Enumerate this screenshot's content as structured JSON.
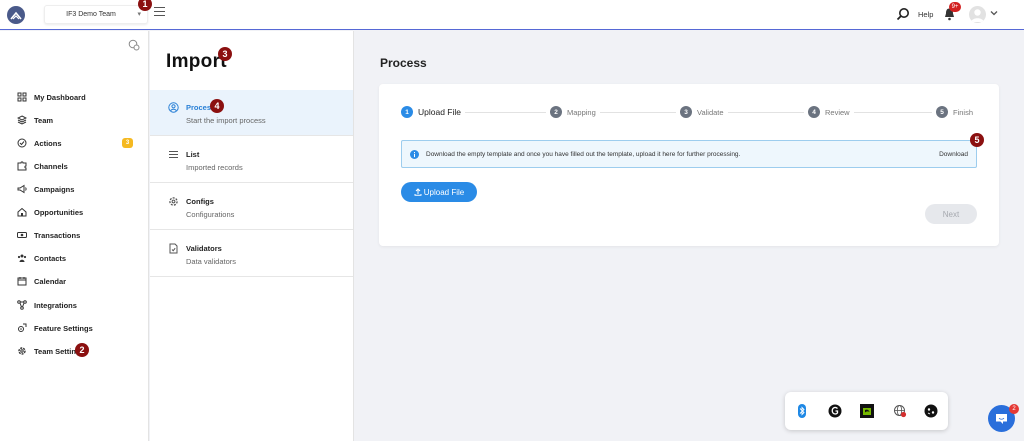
{
  "topbar": {
    "team_name": "IF3 Demo Team",
    "help_label": "Help",
    "notification_count": "9+",
    "accent_color": "#5668d6"
  },
  "callouts": [
    "1",
    "2",
    "3",
    "4",
    "5"
  ],
  "sidebar": {
    "items": [
      {
        "label": "My Dashboard",
        "icon": "grid-icon"
      },
      {
        "label": "Team",
        "icon": "layers-icon"
      },
      {
        "label": "Actions",
        "icon": "check-circle-icon",
        "count": "3"
      },
      {
        "label": "Channels",
        "icon": "puzzle-icon"
      },
      {
        "label": "Campaigns",
        "icon": "megaphone-icon"
      },
      {
        "label": "Opportunities",
        "icon": "home-icon"
      },
      {
        "label": "Transactions",
        "icon": "money-icon"
      },
      {
        "label": "Contacts",
        "icon": "people-icon"
      },
      {
        "label": "Calendar",
        "icon": "calendar-icon"
      },
      {
        "label": "Integrations",
        "icon": "network-icon"
      },
      {
        "label": "Feature Settings",
        "icon": "feature-gear-icon"
      },
      {
        "label": "Team Settings",
        "icon": "gear-icon"
      }
    ]
  },
  "import_panel": {
    "title": "Import",
    "items": [
      {
        "title": "Process",
        "subtitle": "Start the import process",
        "icon": "user-circle-icon",
        "active": true
      },
      {
        "title": "List",
        "subtitle": "Imported records",
        "icon": "list-icon"
      },
      {
        "title": "Configs",
        "subtitle": "Configurations",
        "icon": "cog-icon"
      },
      {
        "title": "Validators",
        "subtitle": "Data validators",
        "icon": "file-check-icon"
      }
    ]
  },
  "main": {
    "title": "Process",
    "steps": [
      {
        "num": "1",
        "label": "Upload File",
        "active": true
      },
      {
        "num": "2",
        "label": "Mapping"
      },
      {
        "num": "3",
        "label": "Validate"
      },
      {
        "num": "4",
        "label": "Review"
      },
      {
        "num": "5",
        "label": "Finish"
      }
    ],
    "info_message": "Download the empty template and once you have filled out the template, upload it here for further processing.",
    "download_label": "Download",
    "upload_label": "Upload File",
    "next_label": "Next",
    "primary_color": "#2a8be6"
  },
  "chat_badge": "2"
}
